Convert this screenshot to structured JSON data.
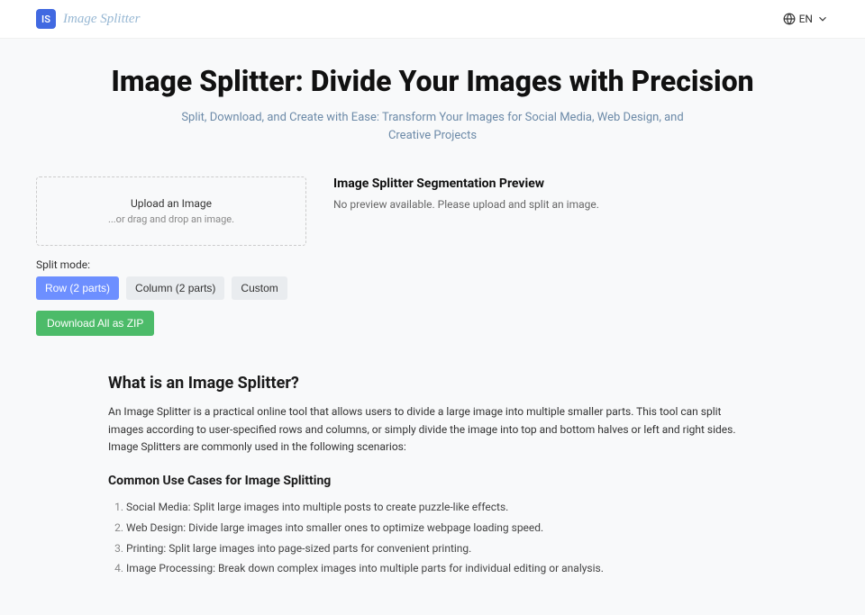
{
  "header": {
    "logo_badge": "IS",
    "logo_text": "Image Splitter",
    "lang": "EN"
  },
  "hero": {
    "title": "Image Splitter: Divide Your Images with Precision",
    "subtitle": "Split, Download, and Create with Ease: Transform Your Images for Social Media, Web Design, and Creative Projects"
  },
  "upload": {
    "title": "Upload an Image",
    "hint": "...or drag and drop an image."
  },
  "preview": {
    "title": "Image Splitter Segmentation Preview",
    "empty_msg": "No preview available. Please upload and split an image."
  },
  "controls": {
    "mode_label": "Split mode:",
    "modes": {
      "row": "Row (2 parts)",
      "column": "Column (2 parts)",
      "custom": "Custom"
    },
    "download": "Download All as ZIP"
  },
  "info": {
    "h2": "What is an Image Splitter?",
    "desc": "An Image Splitter is a practical online tool that allows users to divide a large image into multiple smaller parts. This tool can split images according to user-specified rows and columns, or simply divide the image into top and bottom halves or left and right sides. Image Splitters are commonly used in the following scenarios:",
    "h3": "Common Use Cases for Image Splitting",
    "cases": [
      "Social Media: Split large images into multiple posts to create puzzle-like effects.",
      "Web Design: Divide large images into smaller ones to optimize webpage loading speed.",
      "Printing: Split large images into page-sized parts for convenient printing.",
      "Image Processing: Break down complex images into multiple parts for individual editing or analysis."
    ]
  }
}
